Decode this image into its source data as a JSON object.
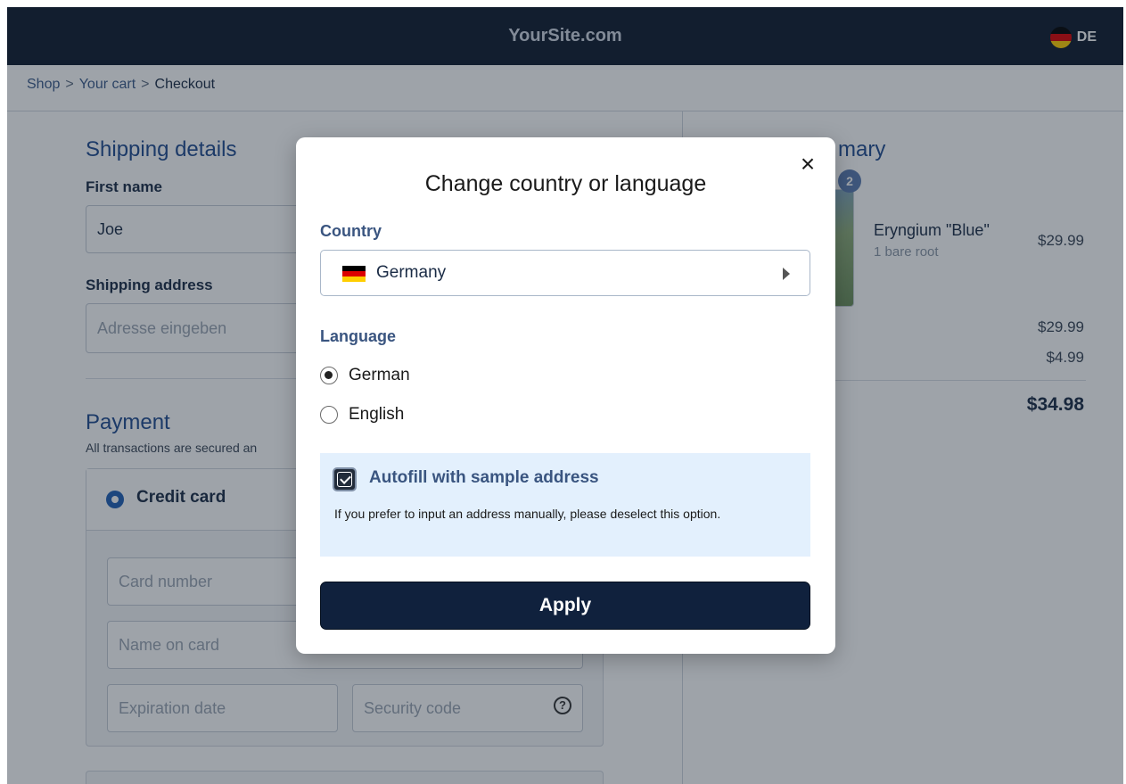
{
  "header": {
    "brand": "YourSite.com",
    "locale_code": "DE"
  },
  "breadcrumb": {
    "items": [
      "Shop",
      "Your cart",
      "Checkout"
    ],
    "separator": ">"
  },
  "shipping": {
    "title": "Shipping details",
    "first_name_label": "First name",
    "first_name_value": "Joe",
    "address_label": "Shipping address",
    "address_placeholder": "Adresse eingeben"
  },
  "payment": {
    "title": "Payment",
    "note": "All transactions are secured an",
    "method_label": "Credit card",
    "card_number_placeholder": "Card number",
    "name_on_card_placeholder": "Name on card",
    "expiration_placeholder": "Expiration date",
    "security_placeholder": "Security code",
    "help_icon": "?"
  },
  "summary": {
    "title_fragment": "mary",
    "qty_badge": "2",
    "product_name": "Eryngium \"Blue\"",
    "product_sub": "1 bare root",
    "product_price": "$29.99",
    "subtotal": "$29.99",
    "shipping": "$4.99",
    "total": "$34.98"
  },
  "modal": {
    "title": "Change country or language",
    "close_icon": "×",
    "country_label": "Country",
    "country_value": "Germany",
    "language_label": "Language",
    "languages": [
      {
        "label": "German",
        "selected": true
      },
      {
        "label": "English",
        "selected": false
      }
    ],
    "autofill_label": "Autofill with sample address",
    "autofill_checked": true,
    "autofill_hint": "If you prefer to input an address manually, please deselect this option.",
    "apply_label": "Apply"
  },
  "colors": {
    "navbar": "#0e1a2e",
    "accent_blue": "#1f4b8f",
    "apply_button": "#10213d",
    "autofill_bg": "#e3f0fd",
    "flag_black": "#000000",
    "flag_red": "#dd0000",
    "flag_gold": "#ffce00"
  }
}
